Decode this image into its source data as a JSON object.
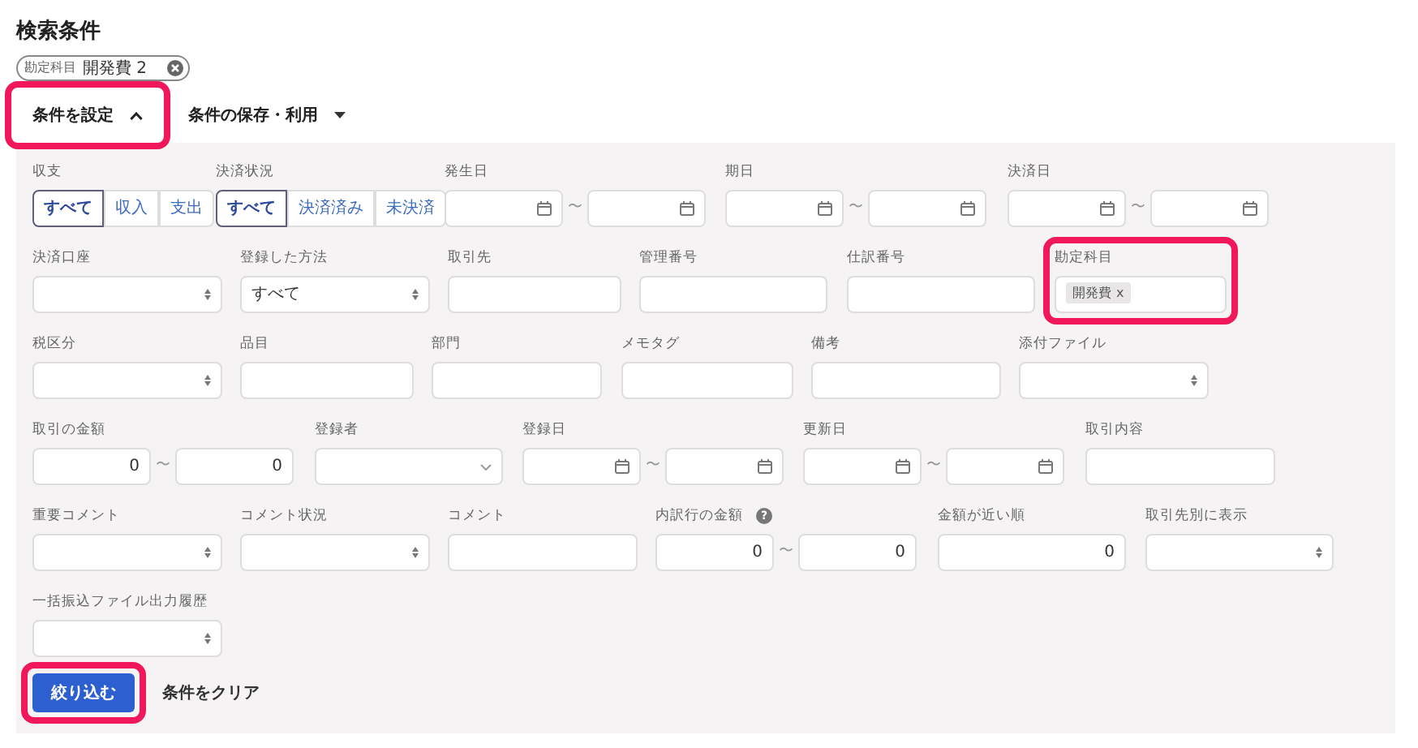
{
  "title": "検索条件",
  "filter_chips": [
    {
      "label": "勘定科目",
      "value": "開発費 2"
    }
  ],
  "toggles": [
    {
      "label": "条件を設定",
      "kind": "expander",
      "expanded": true,
      "highlighted": true
    },
    {
      "label": "条件の保存・利用",
      "kind": "menu",
      "highlighted": false
    }
  ],
  "rows": [
    [
      {
        "kind": "segmented",
        "label": "収支",
        "highlighted": false,
        "options": [
          {
            "label": "すべて",
            "selected": true
          },
          {
            "label": "収入",
            "selected": false
          },
          {
            "label": "支出",
            "selected": false
          }
        ]
      },
      {
        "kind": "segmented",
        "label": "決済状況",
        "highlighted": false,
        "options": [
          {
            "label": "すべて",
            "selected": true
          },
          {
            "label": "決済済み",
            "selected": false
          },
          {
            "label": "未決済",
            "selected": false
          }
        ]
      },
      {
        "kind": "date_range",
        "label": "発生日",
        "separator": "〜",
        "highlighted": false
      },
      {
        "kind": "date_range",
        "label": "期日",
        "separator": "〜",
        "highlighted": false
      },
      {
        "kind": "date_range",
        "label": "決済日",
        "separator": "〜",
        "highlighted": false
      }
    ],
    [
      {
        "kind": "select",
        "label": "決済口座",
        "highlighted": false
      },
      {
        "kind": "select",
        "label": "登録した方法",
        "value": "すべて",
        "highlighted": false
      },
      {
        "kind": "text",
        "label": "取引先",
        "highlighted": false
      },
      {
        "kind": "text",
        "label": "管理番号",
        "highlighted": false
      },
      {
        "kind": "text",
        "label": "仕訳番号",
        "highlighted": false
      },
      {
        "kind": "tags",
        "label": "勘定科目",
        "highlighted": true,
        "tags": [
          {
            "label": "開発費",
            "remove": "x"
          }
        ]
      }
    ],
    [
      {
        "kind": "select",
        "label": "税区分",
        "highlighted": false
      },
      {
        "kind": "text",
        "label": "品目",
        "highlighted": false
      },
      {
        "kind": "text",
        "label": "部門",
        "highlighted": false
      },
      {
        "kind": "text",
        "label": "メモタグ",
        "highlighted": false
      },
      {
        "kind": "text",
        "label": "備考",
        "highlighted": false
      },
      {
        "kind": "select",
        "label": "添付ファイル",
        "highlighted": false
      }
    ],
    [
      {
        "kind": "number_range",
        "label": "取引の金額",
        "from": "0",
        "to": "0",
        "separator": "〜",
        "highlighted": false
      },
      {
        "kind": "combo",
        "label": "登録者",
        "highlighted": false
      },
      {
        "kind": "date_range",
        "label": "登録日",
        "separator": "〜",
        "highlighted": false
      },
      {
        "kind": "date_range",
        "label": "更新日",
        "separator": "〜",
        "highlighted": false
      },
      {
        "kind": "text",
        "label": "取引内容",
        "highlighted": false
      }
    ],
    [
      {
        "kind": "select",
        "label": "重要コメント",
        "highlighted": false
      },
      {
        "kind": "select",
        "label": "コメント状況",
        "highlighted": false
      },
      {
        "kind": "text",
        "label": "コメント",
        "highlighted": false
      },
      {
        "kind": "number_range",
        "label": "内訳行の金額",
        "help": "?",
        "from": "0",
        "to": "0",
        "separator": "〜",
        "highlighted": false
      },
      {
        "kind": "number",
        "label": "金額が近い順",
        "value": "0",
        "highlighted": false
      },
      {
        "kind": "select",
        "label": "取引先別に表示",
        "highlighted": false
      }
    ],
    [
      {
        "kind": "select",
        "label": "一括振込ファイル出力履歴",
        "highlighted": false
      }
    ]
  ],
  "actions": [
    {
      "label": "絞り込む",
      "kind": "primary",
      "highlighted": true
    },
    {
      "label": "条件をクリア",
      "kind": "link",
      "highlighted": false
    }
  ]
}
